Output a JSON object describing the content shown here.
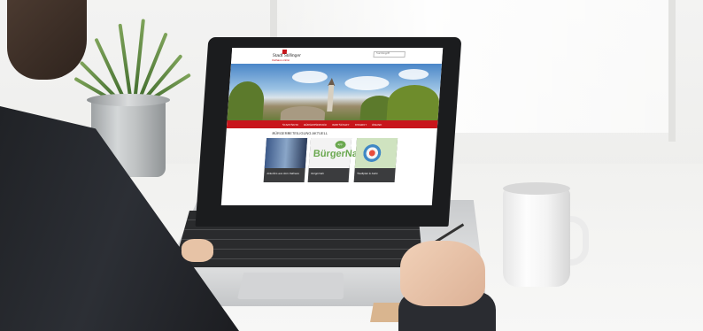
{
  "website": {
    "logo_title": "Stadt Stillinger",
    "logo_subtitle": "Rathaus online",
    "search_placeholder": "Suchbegriff",
    "nav": [
      "STARTSEITE",
      "BÜRGERSERVICE",
      "WIRTSCHAFT",
      "FREIZEIT",
      "ONLINE"
    ],
    "section_title": "BÜRGERBETEILIGUNG AKTUELL",
    "tiles": [
      {
        "caption": "Aktuelles aus dem Rathaus"
      },
      {
        "caption": "BürgerNah",
        "brand": "BürgerNah",
        "badge": "app"
      },
      {
        "caption": "Stadtplan & Karte"
      }
    ]
  },
  "colors": {
    "brand_red": "#c8151b",
    "brand_green": "#6aa84f"
  }
}
